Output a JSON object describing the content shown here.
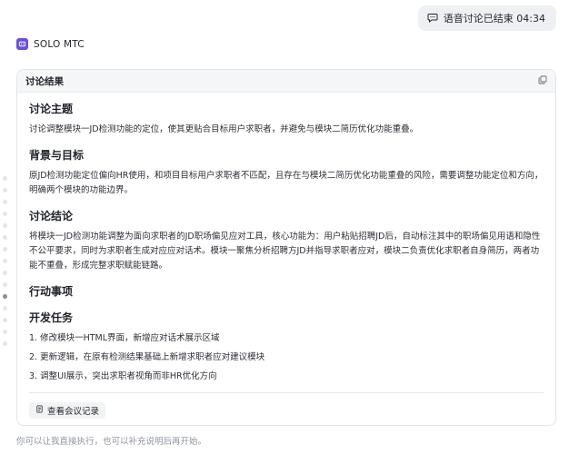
{
  "voice_pill": {
    "label": "语音讨论已结束 04:34",
    "icon": "chat-bubble-icon"
  },
  "sender": {
    "name": "SOLO MTC",
    "icon": "bot-avatar-icon",
    "avatar_color": "#6b4fe0"
  },
  "card": {
    "title": "讨论结果",
    "copy_icon": "copy-icon",
    "sections": {
      "theme": {
        "heading": "讨论主题",
        "text": "讨论调整模块一JD检测功能的定位，使其更贴合目标用户求职者，并避免与模块二简历优化功能重叠。"
      },
      "background": {
        "heading": "背景与目标",
        "text": "原JD检测功能定位偏向HR使用，和项目目标用户求职者不匹配，且存在与模块二简历优化功能重叠的风险，需要调整功能定位和方向，明确两个模块的功能边界。"
      },
      "conclusion": {
        "heading": "讨论结论",
        "text": "将模块一JD检测功能调整为面向求职者的JD职场偏见应对工具，核心功能为：用户粘贴招聘JD后，自动标注其中的职场偏见用语和隐性不公平要求，同时为求职者生成对应应对话术。模块一聚焦分析招聘方JD并指导求职者应对，模块二负责优化求职者自身简历，两者功能不重叠，形成完整求职赋能链路。"
      },
      "actions": {
        "heading": "行动事项"
      },
      "dev_tasks": {
        "heading": "开发任务",
        "items": [
          "1. 修改模块一HTML界面，新增应对话术展示区域",
          "2. 更新逻辑，在原有检测结果基础上新增求职者应对建议模块",
          "3. 调整UI展示，突出求职者视角而非HR优化方向"
        ]
      }
    },
    "record_button": {
      "label": "查看会议记录",
      "icon": "document-icon"
    }
  },
  "footer_hint": "你可以让我直接执行，也可以补充说明后再开始。"
}
